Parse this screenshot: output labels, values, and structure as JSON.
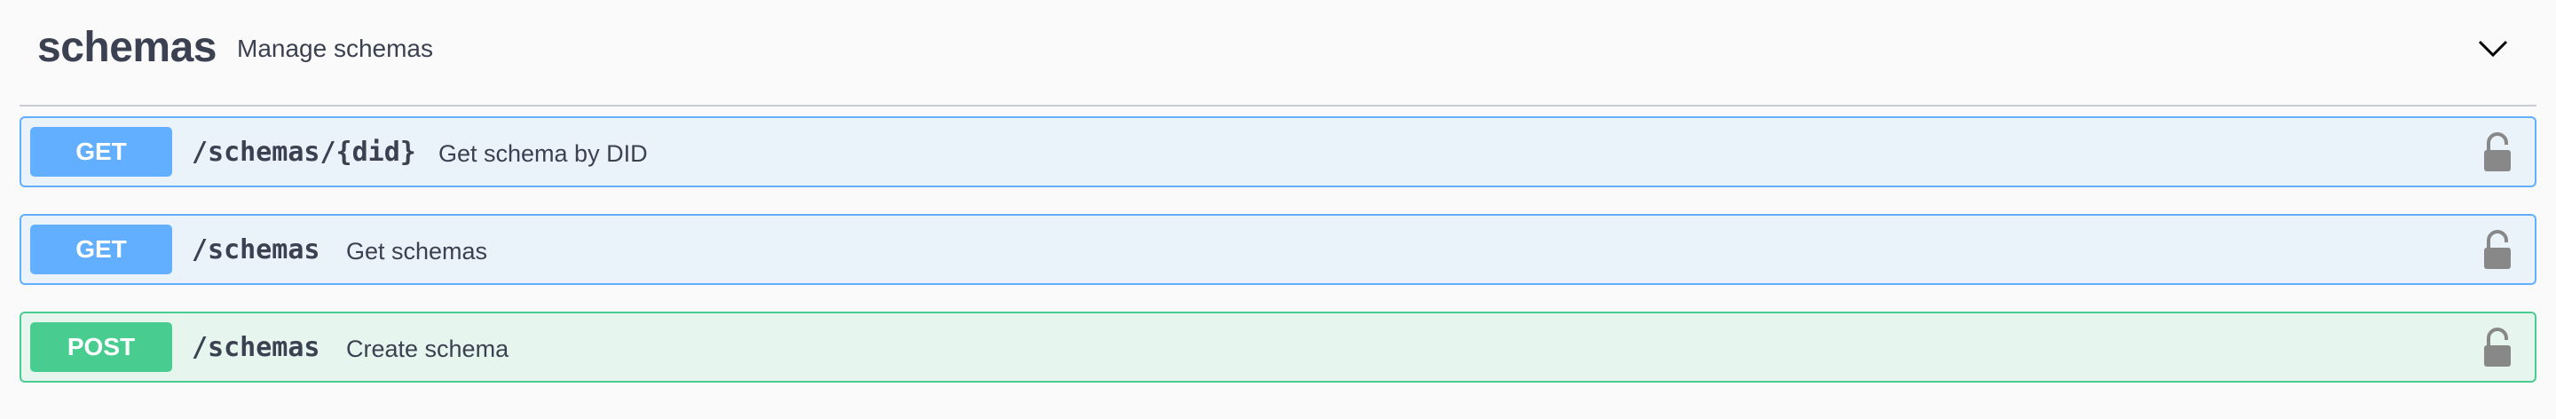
{
  "tag": {
    "name": "schemas",
    "description": "Manage schemas",
    "toggle_icon": "chevron-down-icon"
  },
  "operations": [
    {
      "method": "GET",
      "path": "/schemas/{did}",
      "summary": "Get schema by DID",
      "lock_icon": "unlocked-padlock-icon"
    },
    {
      "method": "GET",
      "path": "/schemas",
      "summary": "Get schemas",
      "lock_icon": "unlocked-padlock-icon"
    },
    {
      "method": "POST",
      "path": "/schemas",
      "summary": "Create schema",
      "lock_icon": "unlocked-padlock-icon"
    }
  ],
  "colors": {
    "get": "#61affe",
    "post": "#49cc90",
    "text": "#3b4151",
    "lock": "#888888"
  }
}
